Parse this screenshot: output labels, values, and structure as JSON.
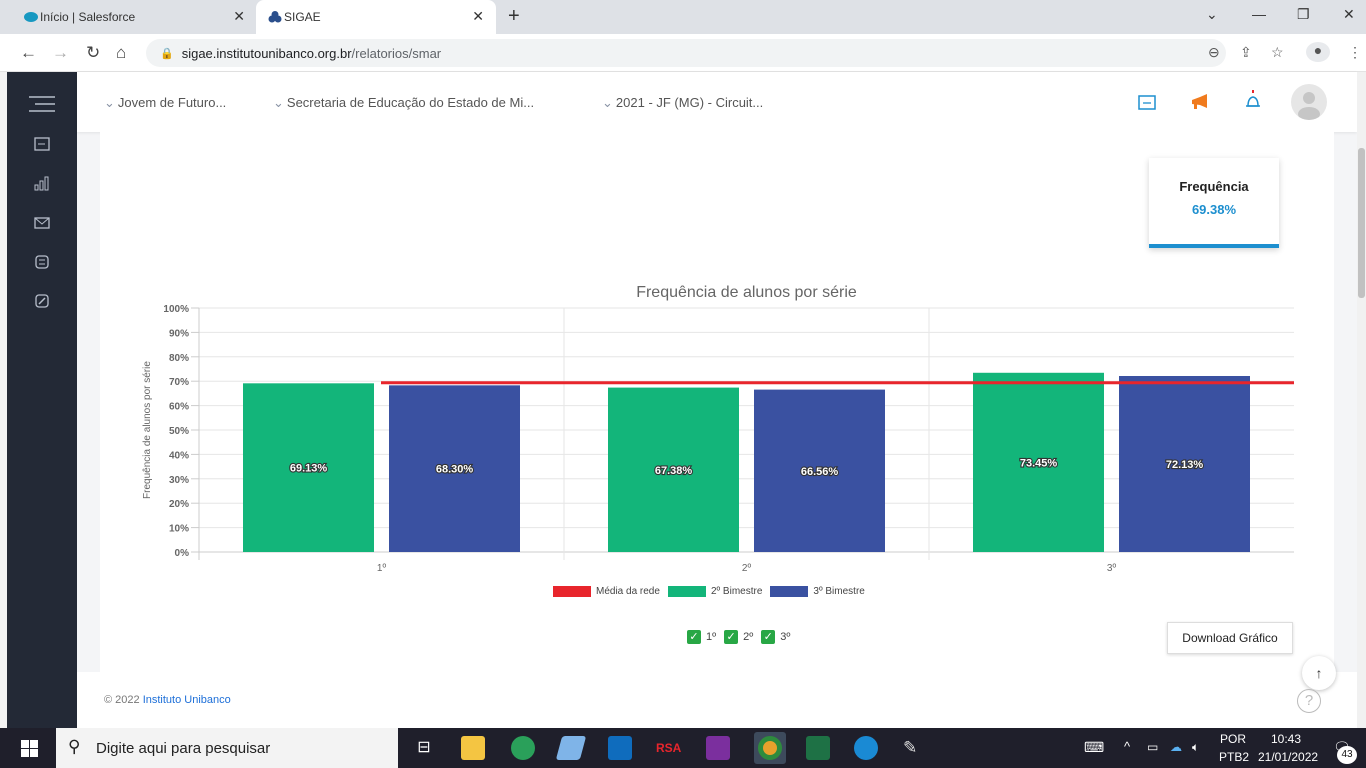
{
  "browser": {
    "tabs": [
      {
        "title": "Início | Salesforce"
      },
      {
        "title": "SIGAE"
      }
    ],
    "url_host": "sigae.institutounibanco.org.br",
    "url_path": "/relatorios/smar"
  },
  "topnav": {
    "crumbs": [
      "Jovem de Futuro...",
      "Secretaria de Educação do Estado de Mi...",
      "2021 - JF (MG) - Circuit..."
    ]
  },
  "summary": {
    "title": "Frequência",
    "value": "69.38%"
  },
  "chart_data": {
    "type": "bar",
    "title": "Frequência de alunos por série",
    "ylabel": "Frequência de alunos por série",
    "categories": [
      "1º",
      "2º",
      "3º"
    ],
    "series": [
      {
        "name": "2º Bimestre",
        "values": [
          69.13,
          67.38,
          73.45
        ],
        "labels": [
          "69.13%",
          "67.38%",
          "73.45%"
        ],
        "color": "#13b57a"
      },
      {
        "name": "3º Bimestre",
        "values": [
          68.3,
          66.56,
          72.13
        ],
        "labels": [
          "68.30%",
          "66.56%",
          "72.13%"
        ],
        "color": "#3a51a1"
      }
    ],
    "reference_line": {
      "name": "Média da rede",
      "value": 69.38,
      "color": "#e8252c"
    },
    "ylim": [
      0,
      100
    ],
    "yticks": [
      "0%",
      "10%",
      "20%",
      "30%",
      "40%",
      "50%",
      "60%",
      "70%",
      "80%",
      "90%",
      "100%"
    ],
    "grid": true,
    "legend_position": "bottom"
  },
  "filters": [
    {
      "label": "1º",
      "checked": true
    },
    {
      "label": "2º",
      "checked": true
    },
    {
      "label": "3º",
      "checked": true
    }
  ],
  "download_label": "Download Gráfico",
  "footer": {
    "copyright": "© 2022",
    "link": "Instituto Unibanco"
  },
  "taskbar": {
    "search_placeholder": "Digite aqui para pesquisar",
    "lang": "POR",
    "layout": "PTB2",
    "time": "10:43",
    "date": "21/01/2022",
    "notifications": "43"
  }
}
